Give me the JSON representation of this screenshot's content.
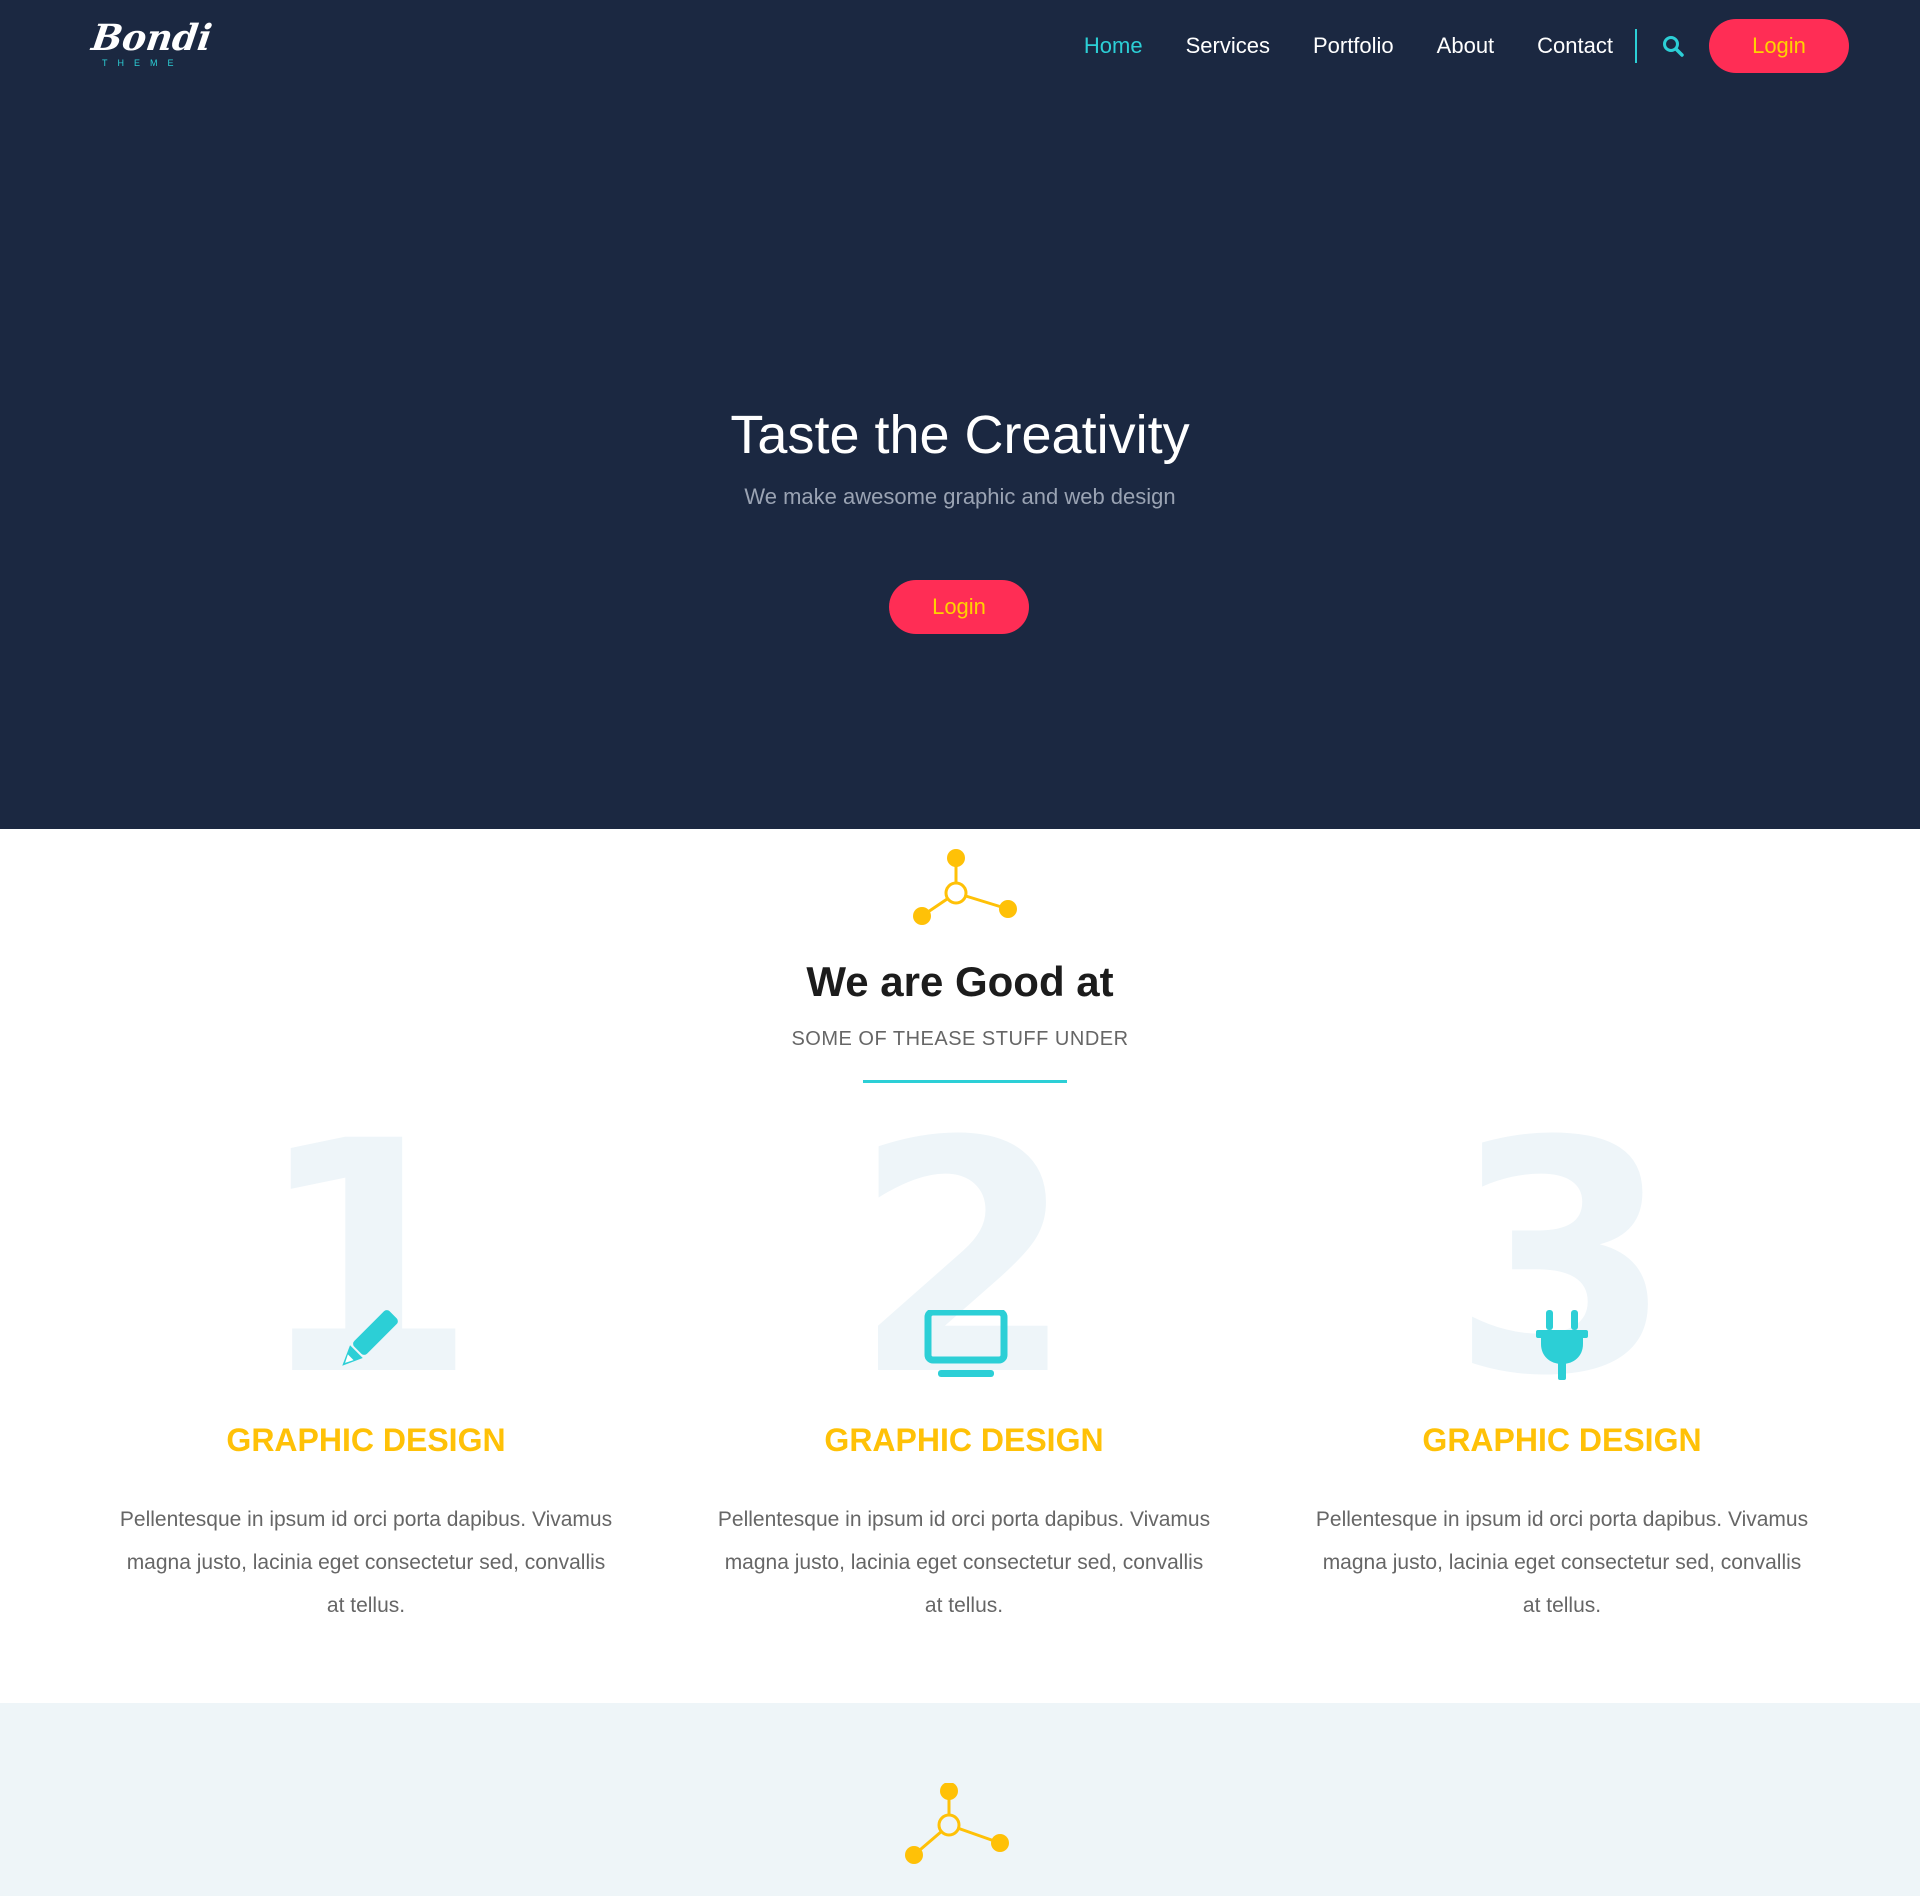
{
  "brand": {
    "name": "Bondi",
    "tagline": "THEME"
  },
  "nav": {
    "items": [
      {
        "label": "Home",
        "active": true
      },
      {
        "label": "Services",
        "active": false
      },
      {
        "label": "Portfolio",
        "active": false
      },
      {
        "label": "About",
        "active": false
      },
      {
        "label": "Contact",
        "active": false
      }
    ],
    "search_icon": "search-icon",
    "login_label": "Login"
  },
  "hero": {
    "title": "Taste the Creativity",
    "subtitle": "We make awesome graphic and web design",
    "button_label": "Login"
  },
  "services": {
    "title": "We are Good at",
    "subtitle": "SOME OF THEASE STUFF UNDER",
    "cards": [
      {
        "number": "1",
        "icon": "pencil-icon",
        "title": "GRAPHIC DESIGN",
        "text": "Pellentesque in ipsum id orci porta dapibus. Vivamus magna justo, lacinia eget consectetur sed, convallis at tellus."
      },
      {
        "number": "2",
        "icon": "monitor-icon",
        "title": "GRAPHIC DESIGN",
        "text": "Pellentesque in ipsum id orci porta dapibus. Vivamus magna justo, lacinia eget consectetur sed, convallis at tellus."
      },
      {
        "number": "3",
        "icon": "plug-icon",
        "title": "GRAPHIC DESIGN",
        "text": "Pellentesque in ipsum id orci porta dapibus. Vivamus magna justo, lacinia eget consectetur sed, convallis at tellus."
      }
    ]
  },
  "colors": {
    "hero_bg": "#1b2841",
    "accent": "#2ccfd6",
    "button": "#ff2d55",
    "button_text": "#ffd200",
    "heading_yellow": "#ffc107",
    "section_alt_bg": "#eef5f8"
  }
}
